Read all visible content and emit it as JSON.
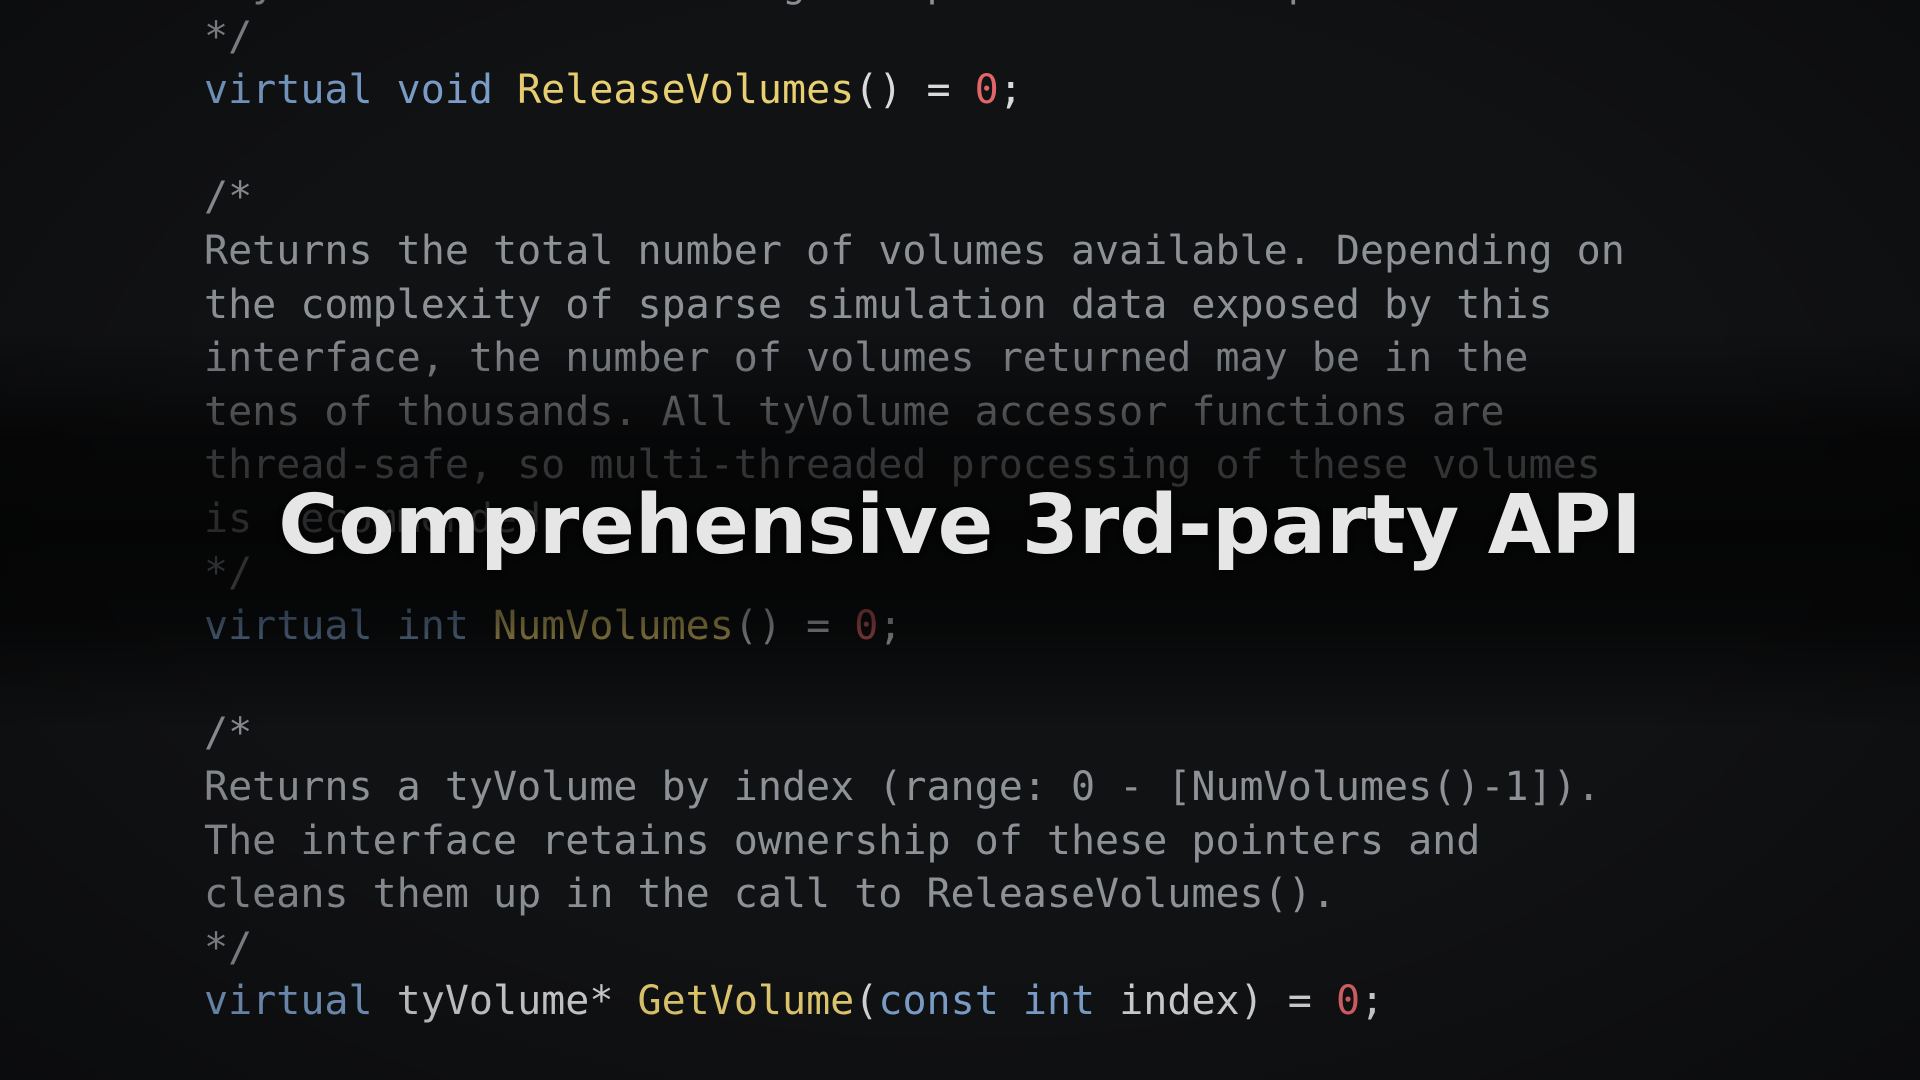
{
  "title": "Comprehensive 3rd-party API",
  "code": {
    "line0": "may have been made during the prior call to UpdateVolumes.",
    "line1": "*/",
    "line2": {
      "k1": "virtual",
      "k2": "void",
      "fn": "ReleaseVolumes",
      "pre": "() = ",
      "num": "0",
      "post": ";"
    },
    "line3": "",
    "line4": "/*",
    "line5": "Returns the total number of volumes available. Depending on",
    "line6": "the complexity of sparse simulation data exposed by this",
    "line7": "interface, the number of volumes returned may be in the",
    "line8": "tens of thousands. All tyVolume accessor functions are",
    "line9": "thread-safe, so multi-threaded processing of these volumes",
    "line10": "is recommended.",
    "line11": "*/",
    "line12": {
      "k1": "virtual",
      "k2": "int",
      "fn": "NumVolumes",
      "pre": "() = ",
      "num": "0",
      "post": ";"
    },
    "line13": "",
    "line14": "/*",
    "line15": "Returns a tyVolume by index (range: 0 - [NumVolumes()-1]).",
    "line16": "The interface retains ownership of these pointers and",
    "line17": "cleans them up in the call to ReleaseVolumes().",
    "line18": "*/",
    "line19": {
      "k1": "virtual",
      "type": "tyVolume*",
      "fn": "GetVolume",
      "open": "(",
      "k2": "const",
      "k3": "int",
      "param": "index",
      "close": ") = ",
      "num": "0",
      "post": ";"
    }
  },
  "colors": {
    "comment": "#8e9297",
    "keyword": "#7fa3cf",
    "function": "#e8cf72",
    "number": "#e0666a",
    "title": "#e6e6e6"
  }
}
